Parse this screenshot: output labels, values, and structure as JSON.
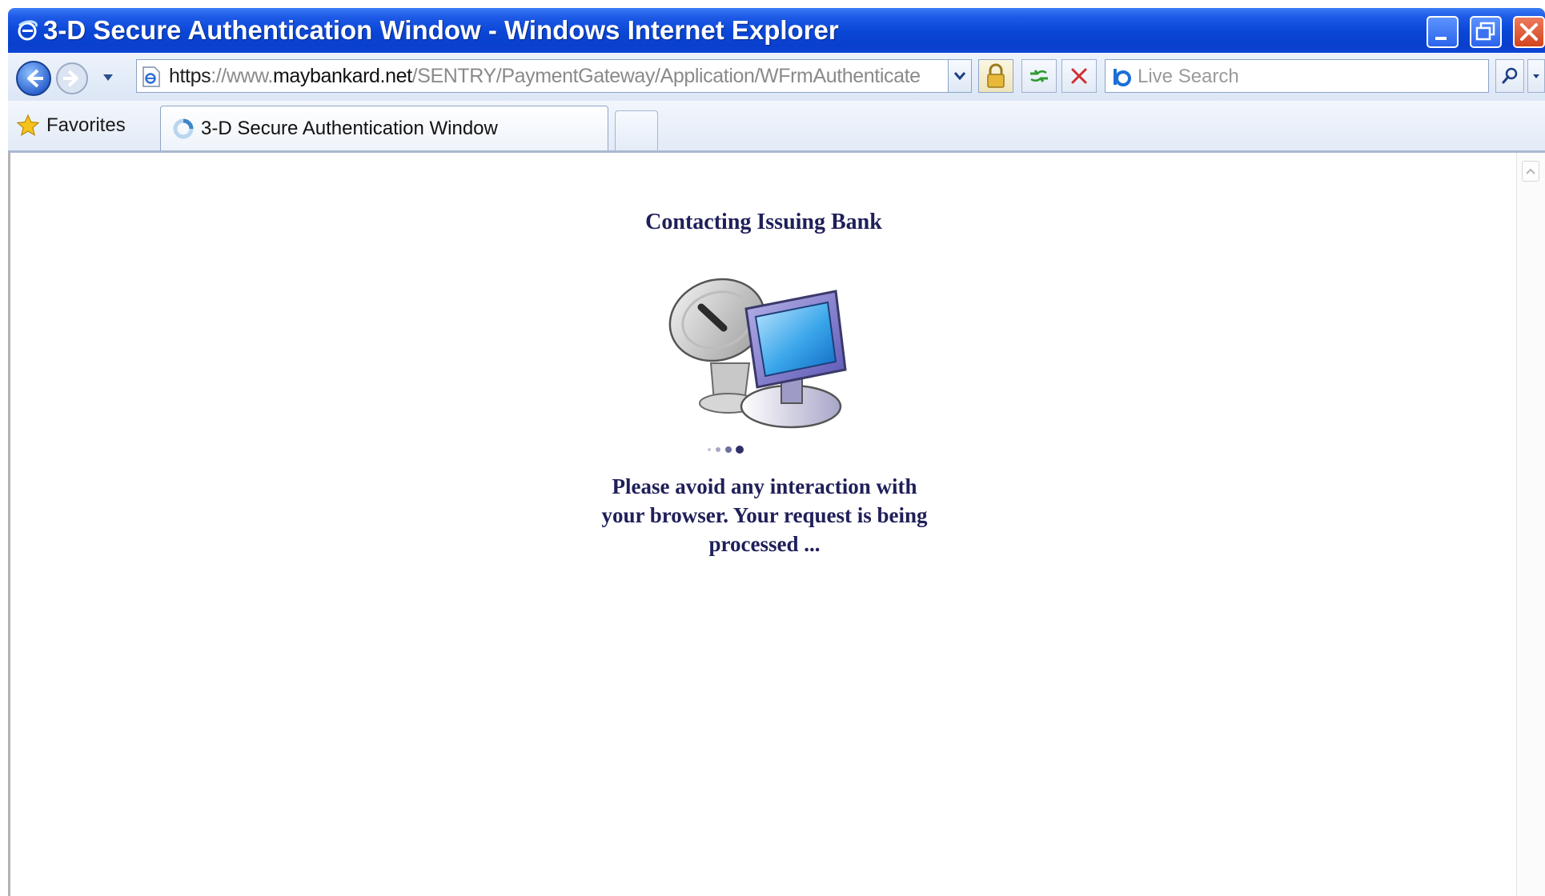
{
  "window": {
    "title": "3-D Secure Authentication Window - Windows Internet Explorer",
    "controls": [
      "minimize-icon",
      "maximize-icon",
      "close-icon"
    ]
  },
  "address_bar": {
    "scheme": "https",
    "separator": "://",
    "www": "www.",
    "domain": "maybankard.net",
    "path": "/SENTRY/PaymentGateway/Application/WFrmAuthenticate..",
    "icons": [
      "back-icon",
      "forward-icon",
      "page-icon",
      "lock-icon",
      "refresh-icon",
      "stop-icon"
    ]
  },
  "search": {
    "placeholder": "Live Search",
    "icon": "live-search-icon"
  },
  "favorites": {
    "label": "Favorites",
    "icon": "star-icon"
  },
  "tab": {
    "label": "3-D Secure Authentication Window",
    "icon": "loading-icon"
  },
  "page": {
    "heading": "Contacting Issuing Bank",
    "message": "Please avoid any interaction with your browser. Your request is being processed ...",
    "illustration": "satellite-computer-icon"
  },
  "colors": {
    "titlebar": "#0a46d6",
    "page_text": "#1f1f5a",
    "toolbar_bg": "#dbe6f6"
  }
}
